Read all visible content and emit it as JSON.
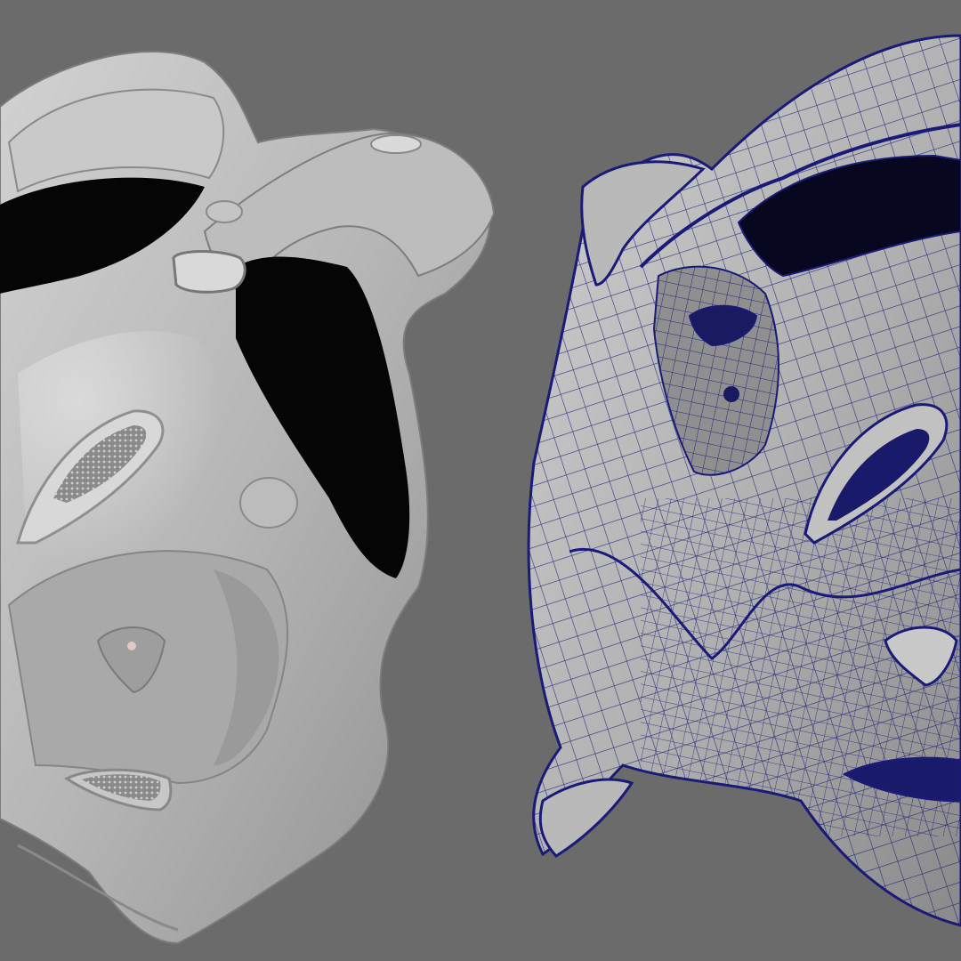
{
  "scene": {
    "background_color": "#6b6b6b",
    "left_model": {
      "render_mode": "shaded",
      "surface_color": "#b8b8b8",
      "cavity_color": "#050505"
    },
    "right_model": {
      "render_mode": "wireframe-on-shaded",
      "surface_color": "#b3b3b3",
      "wire_color": "#1a1a78",
      "cavity_color": "#07071f"
    }
  }
}
